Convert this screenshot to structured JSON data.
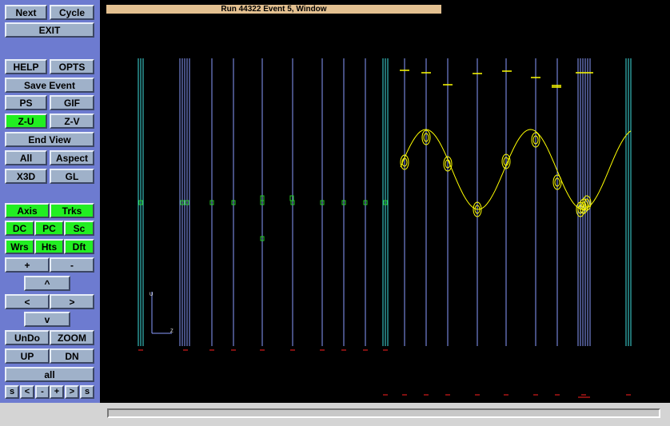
{
  "window_title": "Run 44322 Event 5, Window",
  "colors": {
    "sidebar": "#6d7bd0",
    "button": "#9fb1c9",
    "button_active": "#22ee22",
    "canvas": "#000000",
    "title_bar": "#e3c090",
    "track": "#ffff00",
    "wire_blue": "#8a9bff",
    "wire_cyan": "#40e0e0",
    "hit_green": "#22cc22",
    "marker_red": "#ff2020"
  },
  "buttons": {
    "next": "Next",
    "cycle": "Cycle",
    "exit": "EXIT",
    "help": "HELP",
    "opts": "OPTS",
    "save_event": "Save Event",
    "ps": "PS",
    "gif": "GIF",
    "z_u": "Z-U",
    "z_v": "Z-V",
    "end_view": "End View",
    "all": "All",
    "aspect": "Aspect",
    "x3d": "X3D",
    "gl": "GL",
    "axis": "Axis",
    "trks": "Trks",
    "dc": "DC",
    "pc": "PC",
    "sc": "Sc",
    "wrs": "Wrs",
    "hts": "Hts",
    "dft": "Dft",
    "plus": "+",
    "minus": "-",
    "up_arrow": "^",
    "left_arrow": "<",
    "right_arrow": ">",
    "down_arrow": "v",
    "undo": "UnDo",
    "zoom": "ZOOM",
    "up": "UP",
    "dn": "DN",
    "all_lower": "all",
    "small": [
      "s",
      "<",
      "-",
      "+",
      ">",
      "s"
    ]
  },
  "axis_labels": {
    "vertical": "U",
    "horizontal": "Z"
  }
}
